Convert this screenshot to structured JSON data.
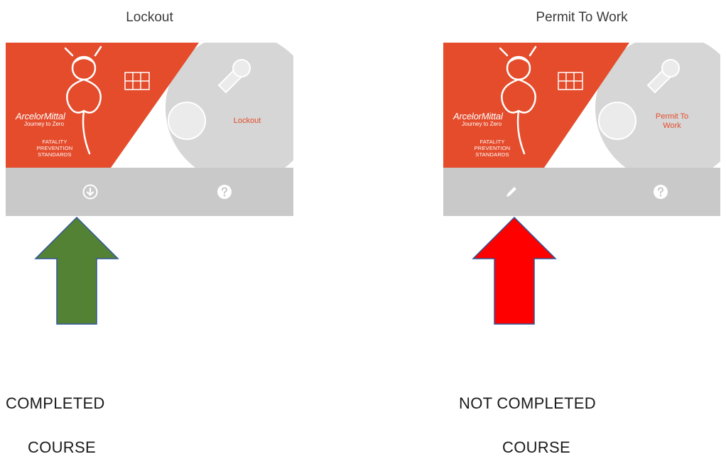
{
  "cards": [
    {
      "title": "Lockout",
      "brand_name": "ArcelorMittal",
      "brand_tagline": "Journey to Zero",
      "fps_lines": [
        "FATALITY",
        "PREVENTION",
        "STANDARDS"
      ],
      "tile_label": "Lockout",
      "actions": {
        "primary_icon": "download-circle-icon",
        "help_icon": "question-circle-icon"
      },
      "arrow_color": "#548235",
      "status_line1": "COMPLETED",
      "status_line2": "COURSE"
    },
    {
      "title": "Permit To Work",
      "brand_name": "ArcelorMittal",
      "brand_tagline": "Journey to Zero",
      "fps_lines": [
        "FATALITY",
        "PREVENTION",
        "STANDARDS"
      ],
      "tile_label": "Permit To Work",
      "actions": {
        "primary_icon": "pencil-icon",
        "help_icon": "question-circle-icon"
      },
      "arrow_color": "#ff0000",
      "status_line1": "NOT COMPLETED",
      "status_line2": "COURSE"
    }
  ],
  "colors": {
    "tile_orange": "#e44c2c",
    "action_bar": "#c9c9c9",
    "arrow_outline": "#2f5597"
  }
}
